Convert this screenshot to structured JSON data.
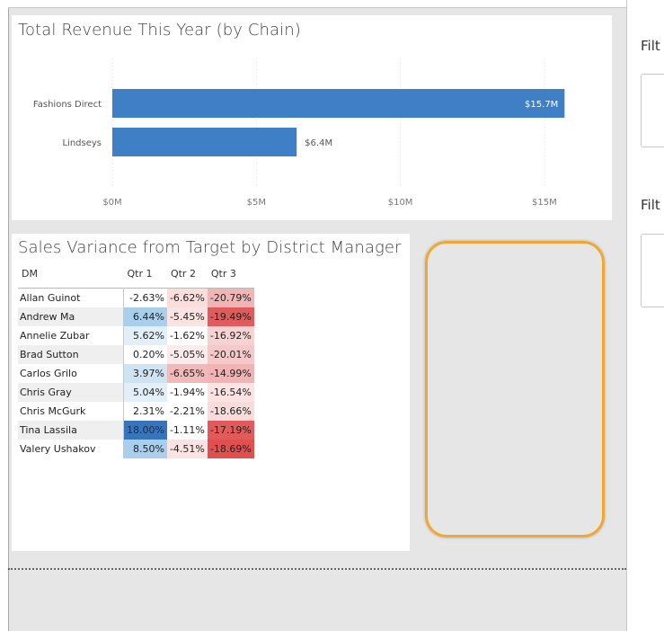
{
  "bar_visual": {
    "title": "Total Revenue This Year (by Chain)"
  },
  "chart_data": {
    "type": "bar",
    "orientation": "horizontal",
    "title": "Total Revenue This Year (by Chain)",
    "categories": [
      "Fashions Direct",
      "Lindseys"
    ],
    "values": [
      15.7,
      6.4
    ],
    "data_labels": [
      "$15.7M",
      "$6.4M"
    ],
    "xlim": [
      0,
      17
    ],
    "ticks": [
      0,
      5,
      10,
      15
    ],
    "tick_labels": [
      "$0M",
      "$5M",
      "$10M",
      "$15M"
    ],
    "grid": true,
    "bar_color": "#3f7fc6"
  },
  "matrix": {
    "title": "Sales Variance from Target by District Manager",
    "columns": [
      "DM",
      "Qtr 1",
      "Qtr 2",
      "Qtr 3"
    ],
    "rows": [
      {
        "dm": "Allan Guinot",
        "q1": "-2.63%",
        "q2": "-6.62%",
        "q3": "-20.79%",
        "bg": [
          "#ffffff",
          "#fadede",
          "#f0b5b5"
        ],
        "fg": [
          "#222",
          "#222",
          "#222"
        ]
      },
      {
        "dm": "Andrew Ma",
        "q1": "6.44%",
        "q2": "-5.45%",
        "q3": "-19.49%",
        "bg": [
          "#a9cfec",
          "#fbe3e3",
          "#e05b5b"
        ],
        "fg": [
          "#222",
          "#222",
          "#222"
        ]
      },
      {
        "dm": "Annelie Zubar",
        "q1": "5.62%",
        "q2": "-1.62%",
        "q3": "-16.92%",
        "bg": [
          "#e2eef8",
          "#ffffff",
          "#f6d3d3"
        ],
        "fg": [
          "#222",
          "#222",
          "#222"
        ]
      },
      {
        "dm": "Brad Sutton",
        "q1": "0.20%",
        "q2": "-5.05%",
        "q3": "-20.01%",
        "bg": [
          "#ffffff",
          "#fcebeb",
          "#f5c9c9"
        ],
        "fg": [
          "#222",
          "#222",
          "#222"
        ]
      },
      {
        "dm": "Carlos Grilo",
        "q1": "3.97%",
        "q2": "-6.65%",
        "q3": "-14.99%",
        "bg": [
          "#cfe3f3",
          "#f2b9b9",
          "#f1b3b3"
        ],
        "fg": [
          "#222",
          "#222",
          "#222"
        ]
      },
      {
        "dm": "Chris Gray",
        "q1": "5.04%",
        "q2": "-1.94%",
        "q3": "-16.54%",
        "bg": [
          "#e2eef8",
          "#ffffff",
          "#fbe3e3"
        ],
        "fg": [
          "#222",
          "#222",
          "#222"
        ]
      },
      {
        "dm": "Chris McGurk",
        "q1": "2.31%",
        "q2": "-2.21%",
        "q3": "-18.66%",
        "bg": [
          "#ffffff",
          "#ffffff",
          "#f8dcdc"
        ],
        "fg": [
          "#222",
          "#222",
          "#222"
        ]
      },
      {
        "dm": "Tina Lassila",
        "q1": "18.00%",
        "q2": "-1.11%",
        "q3": "-17.19%",
        "bg": [
          "#3874bb",
          "#ffffff",
          "#e25a5a"
        ],
        "fg": [
          "#1d2f4a",
          "#222",
          "#222"
        ]
      },
      {
        "dm": "Valery Ushakov",
        "q1": "8.50%",
        "q2": "-4.51%",
        "q3": "-18.69%",
        "bg": [
          "#a9cfec",
          "#fbe3e3",
          "#e14f4f"
        ],
        "fg": [
          "#222",
          "#222",
          "#222"
        ]
      }
    ]
  },
  "filters": {
    "heading_1": "Filt",
    "heading_2": "Filt"
  },
  "colors": {
    "accent_orange": "#f1a833",
    "canvas_gray": "#e6e6e6"
  }
}
